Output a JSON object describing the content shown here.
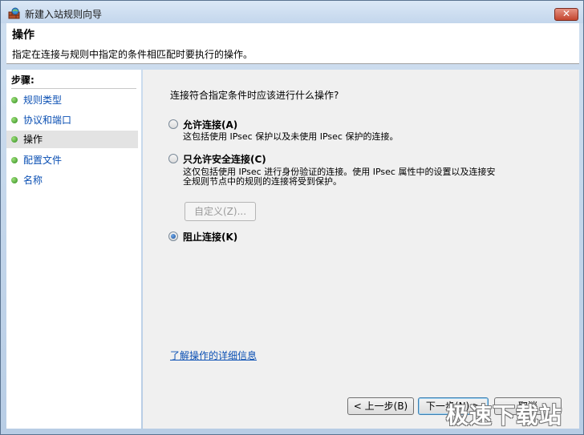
{
  "window": {
    "title": "新建入站规则向导",
    "close_label": "✕"
  },
  "header": {
    "title": "操作",
    "description": "指定在连接与规则中指定的条件相匹配时要执行的操作。"
  },
  "sidebar": {
    "steps_label": "步骤:",
    "items": [
      {
        "label": "规则类型"
      },
      {
        "label": "协议和端口"
      },
      {
        "label": "操作"
      },
      {
        "label": "配置文件"
      },
      {
        "label": "名称"
      }
    ]
  },
  "main": {
    "question": "连接符合指定条件时应该进行什么操作?",
    "options": [
      {
        "label": "允许连接(A)",
        "description": [
          "这包括使用 IPsec 保护以及未使用 IPsec 保护的连接。"
        ],
        "checked": false
      },
      {
        "label": "只允许安全连接(C)",
        "description": [
          "这仅包括使用 IPsec 进行身份验证的连接。使用 IPsec 属性中的设置以及连接安",
          "全规则节点中的规则的连接将受到保护。"
        ],
        "checked": false
      },
      {
        "label": "阻止连接(K)",
        "description": [],
        "checked": true
      }
    ],
    "customize_label": "自定义(Z)...",
    "help_link": "了解操作的详细信息"
  },
  "footer": {
    "back_label": "< 上一步(B)",
    "next_label": "下一步(N) >",
    "cancel_label": "取消"
  },
  "watermark": "极速下载站"
}
